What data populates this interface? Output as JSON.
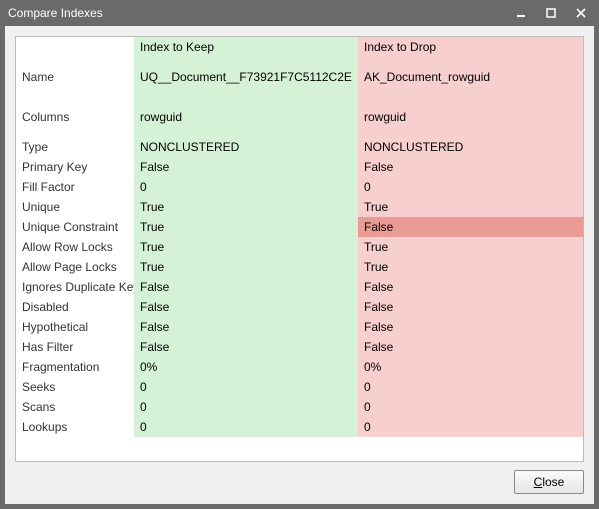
{
  "window": {
    "title": "Compare Indexes",
    "close_label": "Close"
  },
  "headers": {
    "keep": "Index to Keep",
    "drop": "Index to Drop"
  },
  "rows": [
    {
      "label": "Name",
      "keep": "UQ__Document__F73921F7C5112C2E",
      "drop": "AK_Document_rowguid",
      "tall": true
    },
    {
      "label": "Columns",
      "keep": "rowguid",
      "drop": "rowguid",
      "tall": true
    },
    {
      "label": "Type",
      "keep": "NONCLUSTERED",
      "drop": "NONCLUSTERED"
    },
    {
      "label": "Primary Key",
      "keep": "False",
      "drop": "False"
    },
    {
      "label": "Fill Factor",
      "keep": "0",
      "drop": "0"
    },
    {
      "label": "Unique",
      "keep": "True",
      "drop": "True"
    },
    {
      "label": "Unique Constraint",
      "keep": "True",
      "drop": "False",
      "diff": true
    },
    {
      "label": "Allow Row Locks",
      "keep": "True",
      "drop": "True"
    },
    {
      "label": "Allow Page Locks",
      "keep": "True",
      "drop": "True"
    },
    {
      "label": "Ignores Duplicate Keys",
      "keep": "False",
      "drop": "False"
    },
    {
      "label": "Disabled",
      "keep": "False",
      "drop": "False"
    },
    {
      "label": "Hypothetical",
      "keep": "False",
      "drop": "False"
    },
    {
      "label": "Has Filter",
      "keep": "False",
      "drop": "False"
    },
    {
      "label": "Fragmentation",
      "keep": "0%",
      "drop": "0%"
    },
    {
      "label": "Seeks",
      "keep": "0",
      "drop": "0"
    },
    {
      "label": "Scans",
      "keep": "0",
      "drop": "0"
    },
    {
      "label": "Lookups",
      "keep": "0",
      "drop": "0"
    }
  ]
}
